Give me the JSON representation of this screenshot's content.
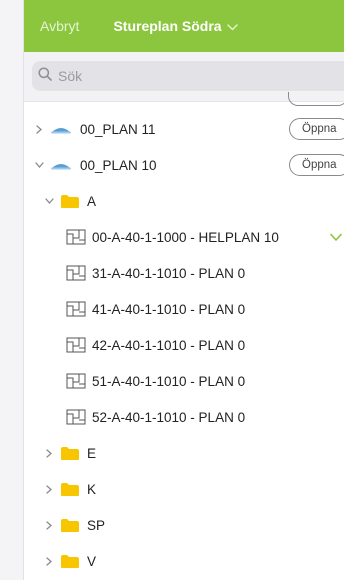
{
  "header": {
    "cancel_label": "Avbryt",
    "title": "Stureplan Södra",
    "accent_color": "#8cc63f"
  },
  "search": {
    "placeholder": "Sök"
  },
  "tree": {
    "open_label": "Öppna",
    "plans": [
      {
        "label": "00_PLAN 11",
        "expanded": false
      },
      {
        "label": "00_PLAN 10",
        "expanded": true
      }
    ],
    "folder_a": {
      "label": "A",
      "expanded": true
    },
    "documents": [
      {
        "label": "00-A-40-1-1000 - HELPLAN 10",
        "selected": true
      },
      {
        "label": "31-A-40-1-1010 - PLAN 0"
      },
      {
        "label": "41-A-40-1-1010 - PLAN 0"
      },
      {
        "label": "42-A-40-1-1010 - PLAN 0"
      },
      {
        "label": "51-A-40-1-1010 - PLAN 0"
      },
      {
        "label": "52-A-40-1-1010 - PLAN 0"
      }
    ],
    "other_folders": [
      {
        "label": "E"
      },
      {
        "label": "K"
      },
      {
        "label": "SP"
      },
      {
        "label": "V"
      }
    ],
    "icons": {
      "expander_collapsed": "chevron-right-icon",
      "expander_expanded": "chevron-down-icon",
      "plan": "floor-plan-layer-icon",
      "folder": "folder-icon",
      "document": "drawing-sheet-icon",
      "selected": "checkmark-icon"
    },
    "colors": {
      "folder": "#f7c600",
      "plan": "#5a9fd4",
      "check": "#8cc63f"
    }
  }
}
